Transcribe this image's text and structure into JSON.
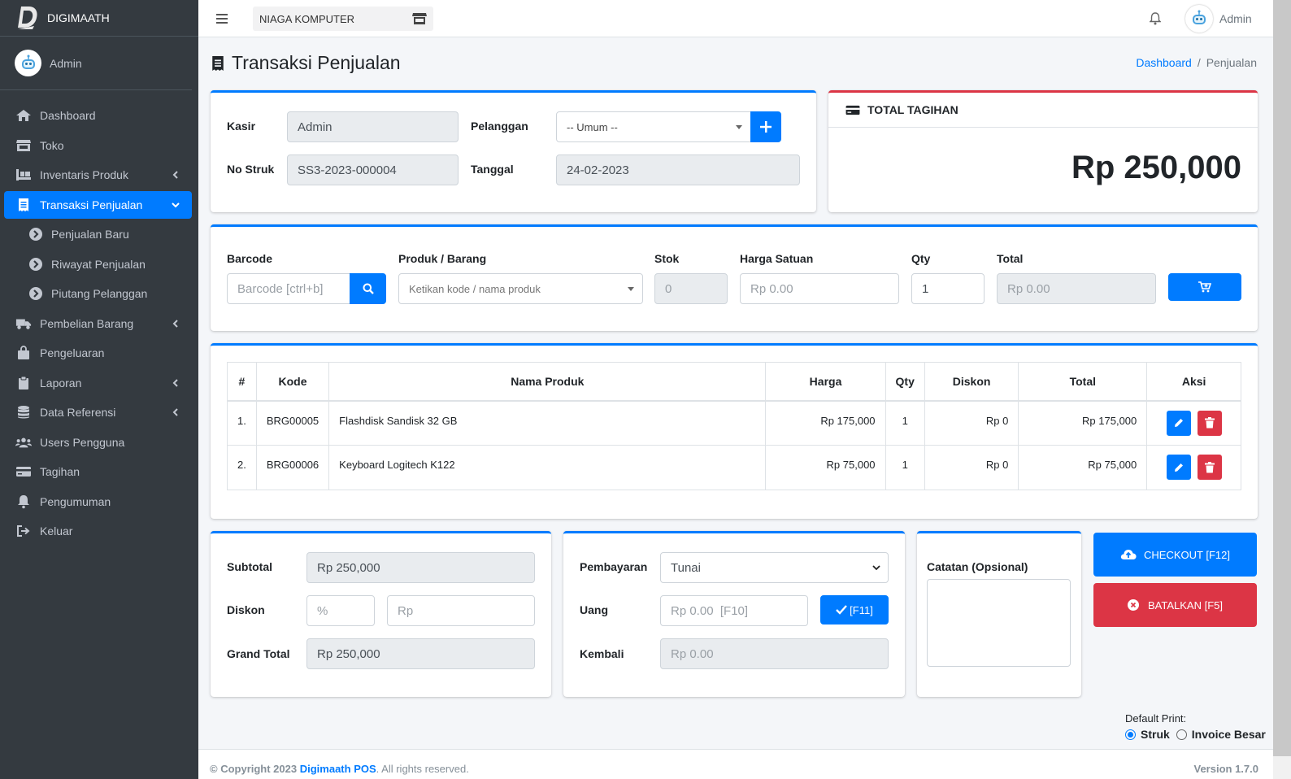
{
  "brand": {
    "name": "DIGIMAATH"
  },
  "user": {
    "name": "Admin"
  },
  "sidebar": {
    "items": [
      {
        "label": "Dashboard",
        "icon": "home-icon"
      },
      {
        "label": "Toko",
        "icon": "store-icon"
      },
      {
        "label": "Inventaris Produk",
        "icon": "pallet-icon",
        "has_children": true
      },
      {
        "label": "Transaksi Penjualan",
        "icon": "receipt-icon",
        "active": true,
        "has_children": true
      },
      {
        "label": "Penjualan Baru",
        "icon": "chevron-circle-right-icon",
        "sub": true
      },
      {
        "label": "Riwayat Penjualan",
        "icon": "chevron-circle-right-icon",
        "sub": true
      },
      {
        "label": "Piutang Pelanggan",
        "icon": "chevron-circle-right-icon",
        "sub": true
      },
      {
        "label": "Pembelian Barang",
        "icon": "truck-icon",
        "has_children": true
      },
      {
        "label": "Pengeluaran",
        "icon": "shopping-bag-icon"
      },
      {
        "label": "Laporan",
        "icon": "clipboard-icon",
        "has_children": true
      },
      {
        "label": "Data Referensi",
        "icon": "database-icon",
        "has_children": true
      },
      {
        "label": "Users Pengguna",
        "icon": "users-icon"
      },
      {
        "label": "Tagihan",
        "icon": "credit-card-icon"
      },
      {
        "label": "Pengumuman",
        "icon": "bell-icon"
      },
      {
        "label": "Keluar",
        "icon": "sign-out-icon"
      }
    ]
  },
  "topbar": {
    "store": "NIAGA KOMPUTER",
    "user": "Admin"
  },
  "page": {
    "title": "Transaksi Penjualan"
  },
  "breadcrumb": {
    "home": "Dashboard",
    "current": "Penjualan"
  },
  "header_form": {
    "kasir_label": "Kasir",
    "kasir_value": "Admin",
    "pelanggan_label": "Pelanggan",
    "pelanggan_value": "-- Umum --",
    "nostruk_label": "No Struk",
    "nostruk_value": "SS3-2023-000004",
    "tanggal_label": "Tanggal",
    "tanggal_value": "24-02-2023"
  },
  "total_tagihan": {
    "title": "TOTAL TAGIHAN",
    "amount": "Rp 250,000"
  },
  "entry": {
    "barcode_label": "Barcode",
    "barcode_placeholder": "Barcode [ctrl+b]",
    "produk_label": "Produk / Barang",
    "produk_placeholder": "Ketikan kode / nama produk",
    "stok_label": "Stok",
    "stok_value": "0",
    "harga_label": "Harga Satuan",
    "harga_placeholder": "Rp 0.00",
    "qty_label": "Qty",
    "qty_value": "1",
    "total_label": "Total",
    "total_value": "Rp 0.00"
  },
  "table": {
    "headers": [
      "#",
      "Kode",
      "Nama Produk",
      "Harga",
      "Qty",
      "Diskon",
      "Total",
      "Aksi"
    ],
    "rows": [
      {
        "no": "1.",
        "kode": "BRG00005",
        "nama": "Flashdisk Sandisk 32 GB",
        "harga": "Rp 175,000",
        "qty": "1",
        "diskon": "Rp 0",
        "total": "Rp 175,000"
      },
      {
        "no": "2.",
        "kode": "BRG00006",
        "nama": "Keyboard Logitech K122",
        "harga": "Rp 75,000",
        "qty": "1",
        "diskon": "Rp 0",
        "total": "Rp 75,000"
      }
    ]
  },
  "summary": {
    "subtotal_label": "Subtotal",
    "subtotal_value": "Rp 250,000",
    "diskon_label": "Diskon",
    "diskon_pct_placeholder": "%",
    "diskon_rp_placeholder": "Rp",
    "grandtotal_label": "Grand Total",
    "grandtotal_value": "Rp 250,000"
  },
  "payment": {
    "pembayaran_label": "Pembayaran",
    "pembayaran_value": "Tunai",
    "uang_label": "Uang",
    "uang_placeholder": "Rp 0.00  [F10]",
    "uang_button": "[F11]",
    "kembali_label": "Kembali",
    "kembali_value": "Rp 0.00"
  },
  "notes": {
    "label": "Catatan (Opsional)"
  },
  "actions": {
    "checkout": "CHECKOUT [F12]",
    "cancel": "BATALKAN [F5]"
  },
  "print": {
    "label": "Default Print:",
    "opt1": "Struk",
    "opt2": "Invoice Besar"
  },
  "footer": {
    "copyright": "© Copyright 2023",
    "brand": "Digimaath POS",
    "rights": ". All rights reserved.",
    "version": "Version 1.7.0"
  },
  "colors": {
    "primary": "#007bff",
    "danger": "#dc3545",
    "sidebar": "#343a40"
  }
}
